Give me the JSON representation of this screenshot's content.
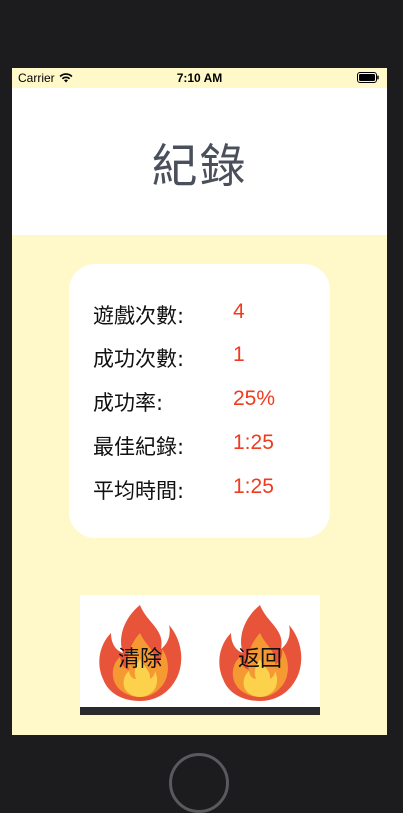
{
  "status_bar": {
    "carrier": "Carrier",
    "time": "7:10 AM"
  },
  "header": {
    "title": "紀錄"
  },
  "stats": [
    {
      "label": "遊戲次數:",
      "value": "4"
    },
    {
      "label": "成功次數:",
      "value": "1"
    },
    {
      "label": "成功率:",
      "value": "25%"
    },
    {
      "label": "最佳紀錄:",
      "value": "1:25"
    },
    {
      "label": "平均時間:",
      "value": "1:25"
    }
  ],
  "actions": {
    "clear_label": "清除",
    "back_label": "返回"
  },
  "colors": {
    "background": "#fff8c8",
    "card": "#ffffff",
    "value_red": "#ef3b1f",
    "title_gray": "#4a4f5c"
  }
}
